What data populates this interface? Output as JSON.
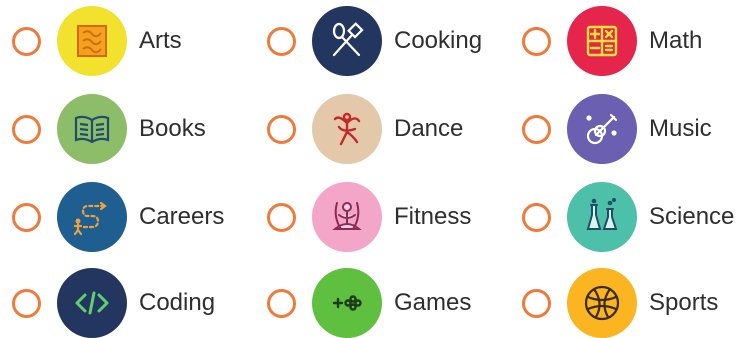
{
  "interests": [
    {
      "label": "Arts",
      "icon": "arts-painting-icon",
      "color": "#f2e22d"
    },
    {
      "label": "Cooking",
      "icon": "cooking-utensils-icon",
      "color": "#23365f"
    },
    {
      "label": "Math",
      "icon": "math-calculator-icon",
      "color": "#e5254b"
    },
    {
      "label": "Books",
      "icon": "open-book-icon",
      "color": "#8dbd69"
    },
    {
      "label": "Dance",
      "icon": "dancer-icon",
      "color": "#e3c8a9"
    },
    {
      "label": "Music",
      "icon": "guitar-icon",
      "color": "#6a5fb0"
    },
    {
      "label": "Careers",
      "icon": "career-path-icon",
      "color": "#1e5e90"
    },
    {
      "label": "Fitness",
      "icon": "meditation-icon",
      "color": "#f3a6c8"
    },
    {
      "label": "Science",
      "icon": "test-tubes-icon",
      "color": "#4cc0a8"
    },
    {
      "label": "Coding",
      "icon": "code-brackets-icon",
      "color": "#23365f"
    },
    {
      "label": "Games",
      "icon": "game-controller-icon",
      "color": "#5fbf3e"
    },
    {
      "label": "Sports",
      "icon": "basketball-icon",
      "color": "#fbb521"
    }
  ],
  "colors": {
    "radio_border": "#f07a3a",
    "label_text": "#2e2e2e"
  }
}
